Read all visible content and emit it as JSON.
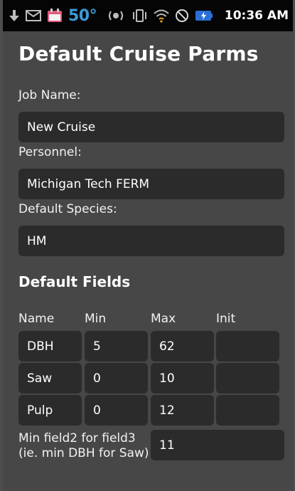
{
  "status_bar": {
    "icons": [
      "download-icon",
      "mail-icon",
      "calendar-icon",
      "vibrate-icon",
      "vibrate-phone-icon",
      "wifi-icon",
      "no-signal-icon",
      "battery-icon"
    ],
    "temperature": "50°",
    "time": "10:36 AM"
  },
  "page": {
    "title": "Default Cruise Parms"
  },
  "form": {
    "job_name_label": "Job Name:",
    "job_name_value": "New Cruise",
    "personnel_label": "Personnel:",
    "personnel_value": "Michigan Tech FERM",
    "species_label": "Default Species:",
    "species_value": "HM"
  },
  "default_fields": {
    "title": "Default Fields",
    "headers": {
      "name": "Name",
      "min": "Min",
      "max": "Max",
      "init": "Init"
    },
    "rows": [
      {
        "name": "DBH",
        "min": "5",
        "max": "62",
        "init": ""
      },
      {
        "name": "Saw",
        "min": "0",
        "max": "10",
        "init": ""
      },
      {
        "name": "Pulp",
        "min": "0",
        "max": "12",
        "init": ""
      }
    ]
  },
  "min_field": {
    "label": "Min field2 for field3 (ie. min DBH for Saw)",
    "value": "11"
  },
  "colors": {
    "background": "#474747",
    "field_background": "#2b2b2b",
    "status_bar": "#050505",
    "temperature_accent": "#3b9bd9"
  }
}
